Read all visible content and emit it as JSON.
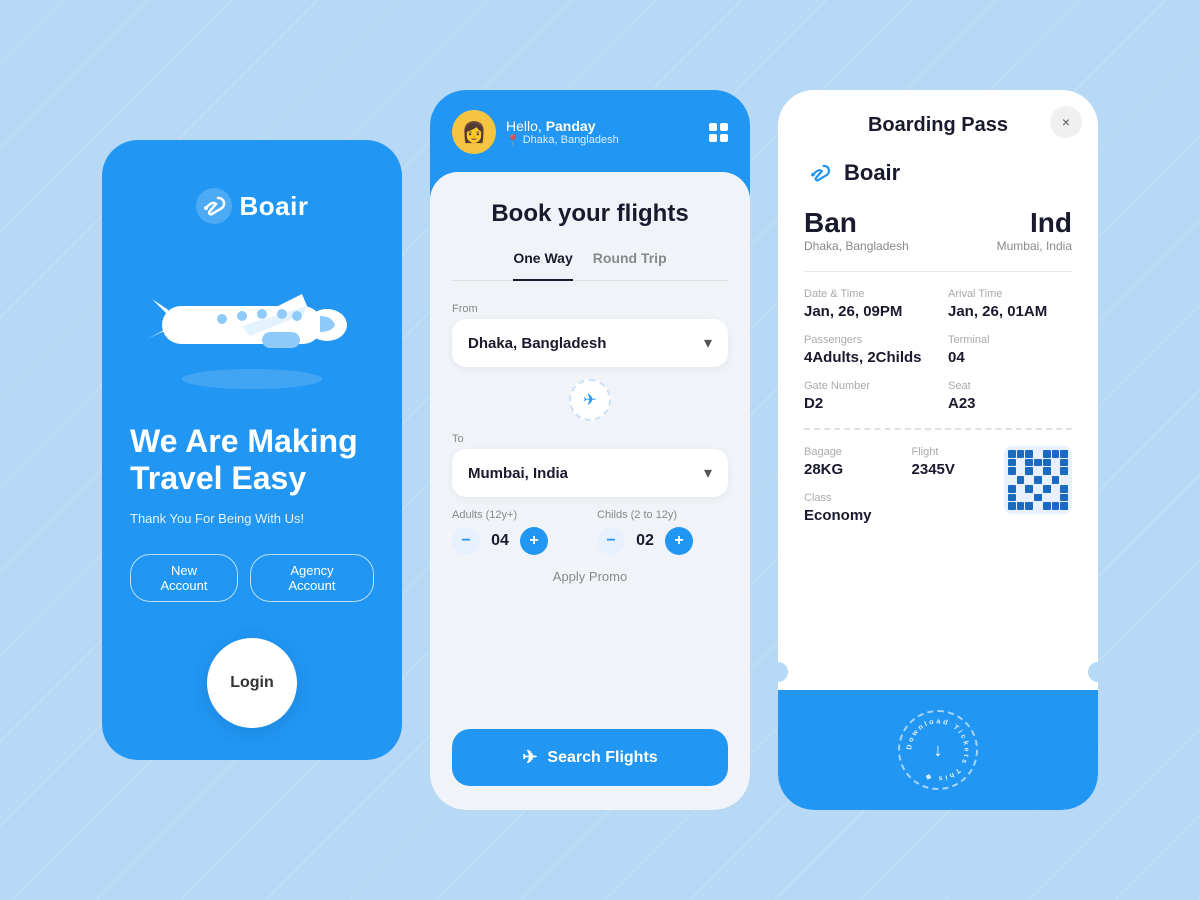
{
  "colors": {
    "primary": "#2196f3",
    "background": "#b8d9f5",
    "dark": "#1a1a2e",
    "white": "#ffffff"
  },
  "phone1": {
    "logo_text": "Boair",
    "heading": "We Are Making Travel Easy",
    "subtext": "Thank You For Being With Us!",
    "btn_new": "New Account",
    "btn_agency": "Agency Account",
    "btn_login": "Login"
  },
  "phone2": {
    "greeting": "Hello, ",
    "username": "Panday",
    "location": "Dhaka, Bangladesh",
    "book_title": "Book your flights",
    "tab_one_way": "One Way",
    "tab_round_trip": "Round Trip",
    "from_label": "From",
    "from_value": "Dhaka, Bangladesh",
    "to_label": "To",
    "to_value": "Mumbai, India",
    "adults_label": "Adults (12y+)",
    "adults_value": "04",
    "childs_label": "Childs (2 to 12y)",
    "childs_value": "02",
    "promo_label": "Apply Promo",
    "search_label": "Search Flights"
  },
  "phone3": {
    "title": "Boarding Pass",
    "logo_text": "Boair",
    "from_code": "Ban",
    "from_city": "Dhaka, Bangladesh",
    "to_code": "Ind",
    "to_city": "Mumbai, India",
    "date_label": "Date & Time",
    "date_value": "Jan, 26, 09PM",
    "arrival_label": "Arival Time",
    "arrival_value": "Jan, 26, 01AM",
    "passengers_label": "Passengers",
    "passengers_value": "4Adults, 2Childs",
    "terminal_label": "Terminal",
    "terminal_value": "04",
    "gate_label": "Gate Number",
    "gate_value": "D2",
    "seat_label": "Seat",
    "seat_value": "A23",
    "baggage_label": "Bagage",
    "baggage_value": "28KG",
    "flight_label": "Flight",
    "flight_value": "2345V",
    "class_label": "Class",
    "class_value": "Economy",
    "download_text": "Download Tickets This",
    "close_label": "×"
  }
}
